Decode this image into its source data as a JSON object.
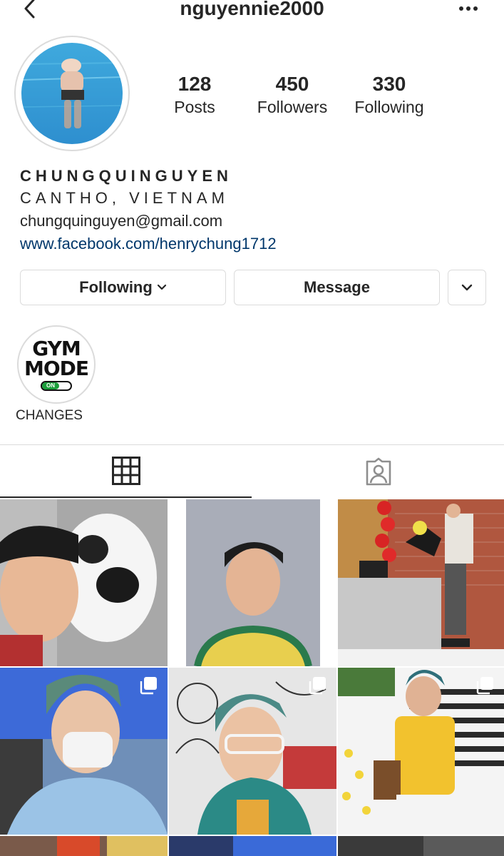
{
  "header": {
    "username": "nguyennie2000",
    "back_icon": "chevron-left-icon",
    "more_icon": "more-horizontal-icon"
  },
  "stats": {
    "posts": {
      "value": "128",
      "label": "Posts"
    },
    "followers": {
      "value": "450",
      "label": "Followers"
    },
    "following": {
      "value": "330",
      "label": "Following"
    }
  },
  "bio": {
    "name": "CHUNGQUINGUYEN",
    "location": "CANTHO, VIETNAM",
    "email": "chungquinguyen@gmail.com",
    "link": "www.facebook.com/henrychung1712"
  },
  "actions": {
    "following_label": "Following",
    "message_label": "Message"
  },
  "highlights": [
    {
      "label": "CHANGES",
      "cover_line1": "GYM",
      "cover_line2": "MODE",
      "toggle_text": "ON"
    }
  ],
  "tabs": {
    "grid_icon": "grid-icon",
    "tagged_icon": "tagged-person-icon",
    "active": "grid"
  },
  "posts_grid": [
    {
      "description": "selfie with dog",
      "multi": false
    },
    {
      "description": "portrait",
      "multi": false
    },
    {
      "description": "birthday party",
      "multi": false
    },
    {
      "description": "classroom with mask",
      "multi": true
    },
    {
      "description": "glasses selfie",
      "multi": true
    },
    {
      "description": "yellow shirt",
      "multi": true
    }
  ],
  "colors": {
    "link": "#00376b",
    "border": "#dbdbdb",
    "text": "#262626",
    "toggle_on": "#1a9e3a"
  }
}
